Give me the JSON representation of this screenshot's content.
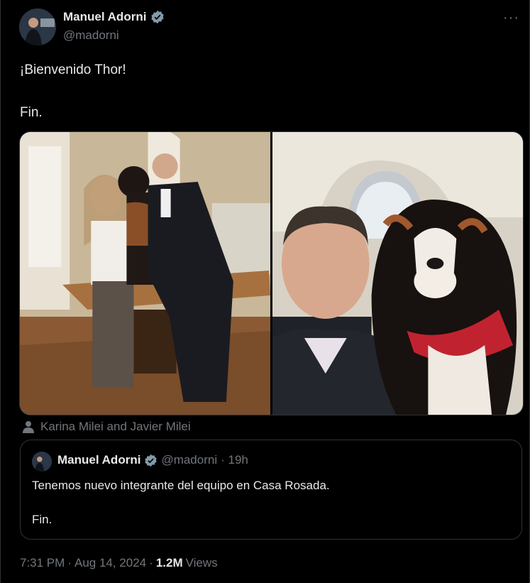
{
  "author": {
    "name": "Manuel Adorni",
    "handle": "@madorni"
  },
  "more_label": "···",
  "tweet": {
    "line1": "¡Bienvenido Thor!",
    "line2": "Fin."
  },
  "tagged": "Karina Milei and Javier Milei",
  "quoted": {
    "name": "Manuel Adorni",
    "handle": "@madorni",
    "time": "· 19h",
    "line1": "Tenemos nuevo integrante del equipo en Casa Rosada.",
    "line2": "Fin."
  },
  "footer": {
    "time": "7:31 PM",
    "sep1": "·",
    "date": "Aug 14, 2024",
    "sep2": "·",
    "views_count": "1.2M",
    "views_label": "Views"
  },
  "colors": {
    "background": "#000000",
    "text": "#e7e9ea",
    "muted": "#71767b",
    "verified": "#829aab",
    "border": "#2f3336"
  }
}
